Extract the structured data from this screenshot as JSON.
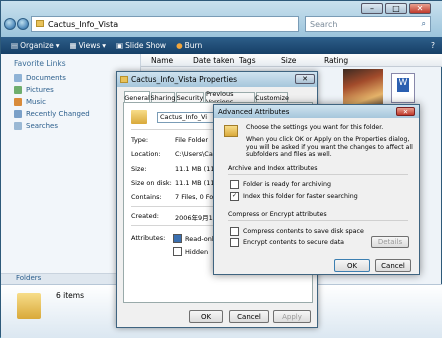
{
  "explorer": {
    "address": "Cactus_Info_Vista",
    "search_placeholder": "Search",
    "toolbar": {
      "organize": "Organize",
      "views": "Views",
      "slideshow": "Slide Show",
      "burn": "Burn"
    },
    "columns": [
      "Name",
      "Date taken",
      "Tags",
      "Size",
      "Rating"
    ],
    "favorites_header": "Favorite Links",
    "favorites": [
      "Documents",
      "Pictures",
      "Music",
      "Recently Changed",
      "Searches"
    ],
    "folders_label": "Folders",
    "detail": "6 items"
  },
  "props": {
    "title": "Cactus_Info_Vista Properties",
    "tabs": [
      "General",
      "Sharing",
      "Security",
      "Previous Versions",
      "Customize"
    ],
    "name_value": "Cactus_Info_Vi",
    "rows": [
      {
        "label": "Type:",
        "value": "File Folder"
      },
      {
        "label": "Location:",
        "value": "C:\\Users\\Cactus"
      },
      {
        "label": "Size:",
        "value": "11.1 MB (11,70"
      },
      {
        "label": "Size on disk:",
        "value": "11.1 MB (11,72"
      },
      {
        "label": "Contains:",
        "value": "7 Files, 0 Folders"
      },
      {
        "label": "Created:",
        "value": "2006年9月18日"
      },
      {
        "label": "Attributes:",
        "value": ""
      }
    ],
    "readonly": "Read-only",
    "hidden": "Hidden",
    "ok": "OK",
    "cancel": "Cancel",
    "apply": "Apply"
  },
  "adv": {
    "title": "Advanced Attributes",
    "intro1": "Choose the settings you want for this folder.",
    "intro2": "When you click OK or Apply on the Properties dialog, you will be asked if you want the changes to affect all subfolders and files as well.",
    "section1": "Archive and Index attributes",
    "opt_archive": "Folder is ready for archiving",
    "opt_index": "Index this folder for faster searching",
    "section2": "Compress or Encrypt attributes",
    "opt_compress": "Compress contents to save disk space",
    "opt_encrypt": "Encrypt contents to secure data",
    "details": "Details",
    "ok": "OK",
    "cancel": "Cancel"
  }
}
